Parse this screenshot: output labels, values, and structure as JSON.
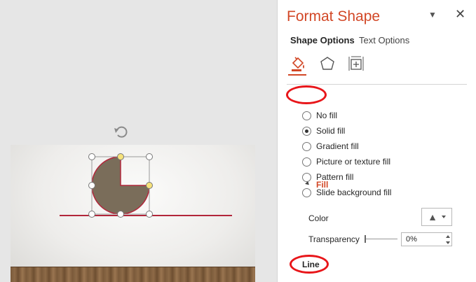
{
  "pane": {
    "title": "Format Shape",
    "tabs": [
      "Shape Options",
      "Text Options"
    ],
    "category_icons": [
      "fill-line-icon",
      "effects-icon",
      "size-properties-icon"
    ],
    "accent_color": "#d24726",
    "highlight_color": "#e8161a",
    "fill_section": {
      "label": "Fill",
      "options": [
        {
          "label": "No fill",
          "checked": false
        },
        {
          "label": "Solid fill",
          "checked": true
        },
        {
          "label": "Gradient fill",
          "checked": false
        },
        {
          "label": "Picture or texture fill",
          "checked": false
        },
        {
          "label": "Pattern fill",
          "checked": false
        },
        {
          "label": "Slide background fill",
          "checked": false
        }
      ],
      "color_label": "Color",
      "transparency_label": "Transparency",
      "transparency_value": "0%"
    },
    "line_section": {
      "label": "Line"
    }
  },
  "shape": {
    "fill_color": "#7a6d5a",
    "outline_color": "#b2263a"
  }
}
